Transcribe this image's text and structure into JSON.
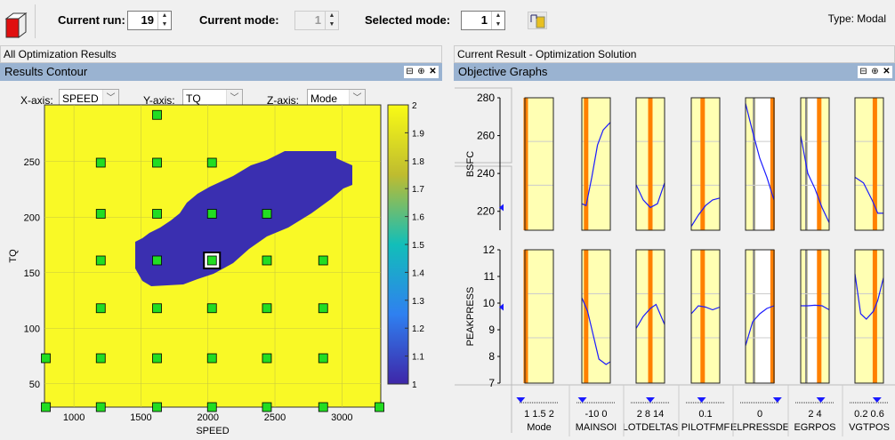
{
  "toolbar": {
    "current_run_label": "Current run:",
    "current_run": "19",
    "current_mode_label": "Current mode:",
    "current_mode": "1",
    "selected_mode_label": "Selected mode:",
    "selected_mode": "1",
    "type_label": "Type: Modal"
  },
  "left": {
    "section_title": "All Optimization Results",
    "panel_title": "Results Contour",
    "x_axis_label": "X-axis:",
    "x_axis_value": "SPEED",
    "y_axis_label": "Y-axis:",
    "y_axis_value": "TQ",
    "z_axis_label": "Z-axis:",
    "z_axis_value": "Mode"
  },
  "right": {
    "section_title": "Current Result - Optimization Solution",
    "panel_title": "Objective Graphs"
  },
  "colors": {
    "accent_header": "#9ab3d1",
    "yellow": "#f9f926",
    "blue": "#3a2fb0",
    "green": "#22dd22",
    "orange": "#ff8000",
    "cell_bg": "#ffffb3",
    "curve": "#1a1aff"
  },
  "chart_data": [
    {
      "type": "heatmap",
      "xlabel": "SPEED",
      "ylabel": "TQ",
      "xlim": [
        780,
        3290
      ],
      "ylim": [
        29,
        301
      ],
      "xticks": [
        "1000",
        "1500",
        "2000",
        "2500",
        "3000"
      ],
      "yticks": [
        "50",
        "100",
        "150",
        "200",
        "250"
      ],
      "zlim": [
        1,
        2
      ],
      "colorbar_ticks": [
        "1",
        "1.1",
        "1.2",
        "1.3",
        "1.4",
        "1.5",
        "1.6",
        "1.7",
        "1.8",
        "1.9",
        "2"
      ],
      "region_mode2": "outside blob",
      "region_mode1": "diagonal blob",
      "points": [
        [
          1620,
          292
        ],
        [
          1200,
          249
        ],
        [
          1620,
          249
        ],
        [
          2030,
          249
        ],
        [
          1200,
          203
        ],
        [
          1620,
          203
        ],
        [
          2030,
          203
        ],
        [
          2440,
          203
        ],
        [
          1200,
          161
        ],
        [
          1620,
          161
        ],
        [
          2030,
          161
        ],
        [
          2440,
          161
        ],
        [
          2860,
          161
        ],
        [
          1200,
          118
        ],
        [
          1620,
          118
        ],
        [
          2030,
          118
        ],
        [
          2440,
          118
        ],
        [
          2860,
          118
        ],
        [
          790,
          73
        ],
        [
          1200,
          73
        ],
        [
          1620,
          73
        ],
        [
          2030,
          73
        ],
        [
          2440,
          73
        ],
        [
          2860,
          73
        ],
        [
          790,
          29
        ],
        [
          1200,
          29
        ],
        [
          1620,
          29
        ],
        [
          2030,
          29
        ],
        [
          2440,
          29
        ],
        [
          2860,
          29
        ],
        [
          3280,
          29
        ]
      ],
      "selected_point": [
        2030,
        161
      ]
    },
    {
      "type": "line",
      "responses": [
        {
          "name": "BSFC",
          "ylim": [
            210,
            280
          ],
          "yticks": [
            "220",
            "240",
            "260",
            "280"
          ],
          "current": 222
        },
        {
          "name": "PEAKPRESS",
          "ylim": [
            7,
            12
          ],
          "yticks": [
            "7",
            "8",
            "9",
            "10",
            "11",
            "12"
          ],
          "current": 9.85
        }
      ],
      "factors": [
        {
          "name": "Mode",
          "ticks": [
            "1",
            "1.5",
            "2"
          ],
          "value": 0.03,
          "bsfc": [],
          "peak": []
        },
        {
          "name": "MAINSOI",
          "ticks": [
            "-10",
            "0"
          ],
          "value": 0.15,
          "bsfc": [
            [
              0,
              224
            ],
            [
              0.15,
              223
            ],
            [
              0.35,
              238
            ],
            [
              0.55,
              255
            ],
            [
              0.75,
              263
            ],
            [
              1,
              267
            ]
          ],
          "peak": [
            [
              0,
              10.2
            ],
            [
              0.2,
              9.7
            ],
            [
              0.4,
              8.8
            ],
            [
              0.6,
              7.9
            ],
            [
              0.85,
              7.7
            ],
            [
              1,
              7.8
            ]
          ]
        },
        {
          "name": "PILOTDELTASOI",
          "label": "LOTDELTAS",
          "ticks": [
            "2",
            "8",
            "14"
          ],
          "value": 0.5,
          "bsfc": [
            [
              0,
              234
            ],
            [
              0.25,
              226
            ],
            [
              0.5,
              222
            ],
            [
              0.75,
              224
            ],
            [
              1,
              235
            ]
          ],
          "peak": [
            [
              0,
              9.05
            ],
            [
              0.25,
              9.5
            ],
            [
              0.5,
              9.8
            ],
            [
              0.7,
              9.95
            ],
            [
              1,
              9.2
            ]
          ]
        },
        {
          "name": "PILOTFMF",
          "ticks": [
            "0.1"
          ],
          "value": 0.4,
          "bsfc": [
            [
              0,
              212
            ],
            [
              0.25,
              218
            ],
            [
              0.5,
              223
            ],
            [
              0.75,
              226
            ],
            [
              1,
              227
            ]
          ],
          "peak": [
            [
              0,
              9.6
            ],
            [
              0.25,
              9.9
            ],
            [
              0.5,
              9.85
            ],
            [
              0.75,
              9.75
            ],
            [
              1,
              9.85
            ]
          ]
        },
        {
          "name": "FUELPRESSDELTA",
          "label": "ELPRESSDE",
          "ticks": [
            "0"
          ],
          "value": 0.95,
          "infeasible": [
            0.35,
            0.9
          ],
          "bsfc": [
            [
              0,
              277
            ],
            [
              0.25,
              262
            ],
            [
              0.5,
              248
            ],
            [
              0.75,
              238
            ],
            [
              1,
              226
            ]
          ],
          "peak": [
            [
              0,
              8.4
            ],
            [
              0.25,
              9.3
            ],
            [
              0.5,
              9.6
            ],
            [
              0.75,
              9.8
            ],
            [
              1,
              9.9
            ]
          ]
        },
        {
          "name": "EGRPOS",
          "ticks": [
            "2",
            "4"
          ],
          "value": 0.65,
          "infeasible": [
            0.25,
            0.65
          ],
          "bsfc": [
            [
              0,
              260
            ],
            [
              0.25,
              240
            ],
            [
              0.5,
              232
            ],
            [
              0.75,
              222
            ],
            [
              1,
              214
            ]
          ],
          "peak": [
            [
              0,
              9.9
            ],
            [
              0.25,
              9.9
            ],
            [
              0.5,
              9.92
            ],
            [
              0.75,
              9.9
            ],
            [
              1,
              9.75
            ]
          ]
        },
        {
          "name": "VGTPOS",
          "ticks": [
            "0.2",
            "0.6"
          ],
          "value": 0.7,
          "bsfc": [
            [
              0,
              238
            ],
            [
              0.3,
              235
            ],
            [
              0.6,
              226
            ],
            [
              0.8,
              219
            ],
            [
              1,
              219
            ]
          ],
          "peak": [
            [
              0,
              11.1
            ],
            [
              0.2,
              9.6
            ],
            [
              0.4,
              9.4
            ],
            [
              0.65,
              9.7
            ],
            [
              0.8,
              10.1
            ],
            [
              1,
              10.95
            ]
          ]
        }
      ]
    }
  ]
}
